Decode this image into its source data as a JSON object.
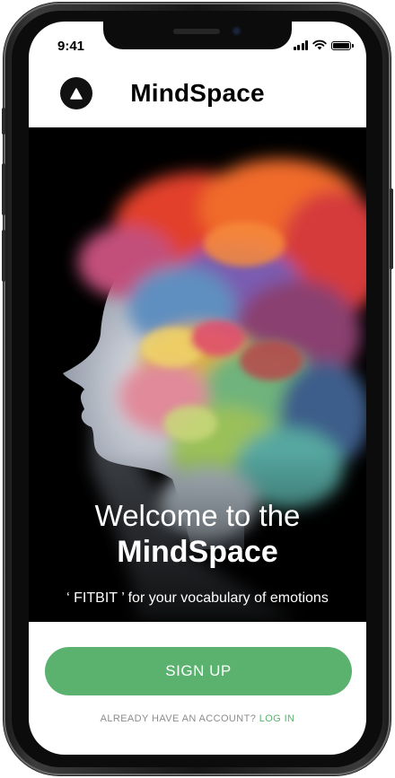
{
  "status_bar": {
    "time": "9:41"
  },
  "header": {
    "title": "MindSpace",
    "logo_icon": "triangle-logo-icon"
  },
  "hero": {
    "welcome_line1": "Welcome to the",
    "welcome_line2": "MindSpace",
    "tagline": "‘ FITBIT ’ for your vocabulary of emotions"
  },
  "actions": {
    "signup_label": "SIGN UP",
    "account_prompt": "ALREADY HAVE AN ACCOUNT?",
    "login_label": "LOG IN"
  },
  "colors": {
    "accent": "#5ab26e",
    "hero_background": "#000000"
  }
}
